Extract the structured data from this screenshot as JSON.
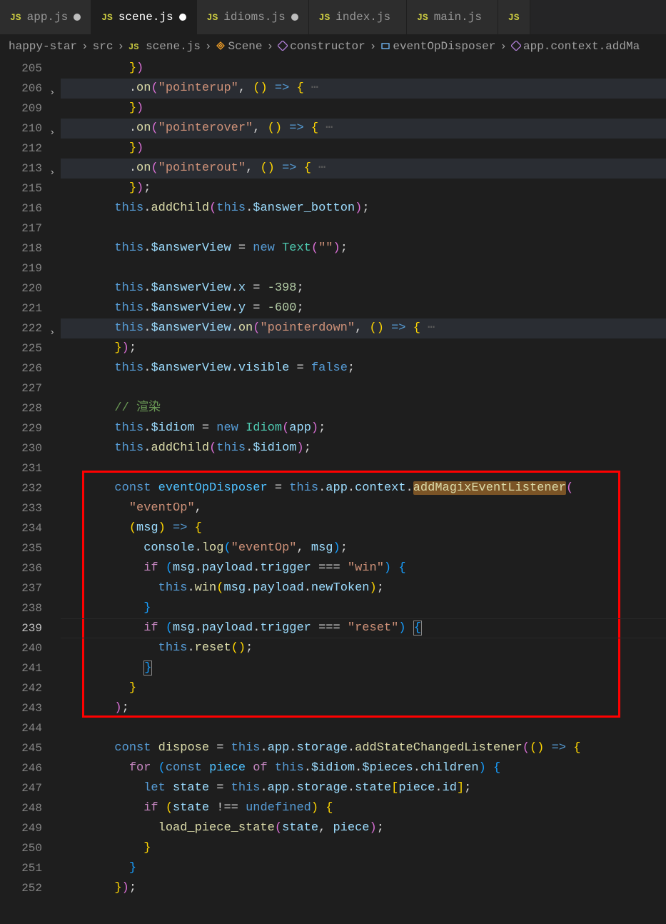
{
  "tabs": [
    {
      "label": "app.js",
      "dirty": true,
      "active": false
    },
    {
      "label": "scene.js",
      "dirty": true,
      "active": true
    },
    {
      "label": "idioms.js",
      "dirty": true,
      "active": false
    },
    {
      "label": "index.js",
      "dirty": false,
      "active": false
    },
    {
      "label": "main.js",
      "dirty": false,
      "active": false
    }
  ],
  "breadcrumbs": {
    "segments": [
      "happy-star",
      "src",
      "scene.js",
      "Scene",
      "constructor",
      "eventOpDisposer",
      "app.context.addMa"
    ]
  },
  "lines": {
    "nums": [
      "205",
      "206",
      "209",
      "210",
      "212",
      "213",
      "215",
      "216",
      "217",
      "218",
      "219",
      "220",
      "221",
      "222",
      "225",
      "226",
      "227",
      "228",
      "229",
      "230",
      "231",
      "232",
      "233",
      "234",
      "235",
      "236",
      "237",
      "238",
      "239",
      "240",
      "241",
      "242",
      "243",
      "244",
      "245",
      "246",
      "247",
      "248",
      "249",
      "250",
      "251",
      "252"
    ],
    "folds": {
      "206": true,
      "210": true,
      "213": true,
      "222": true
    },
    "current": "239"
  },
  "tokens": {
    "pointerup": "\"pointerup\"",
    "pointerover": "\"pointerover\"",
    "pointerout": "\"pointerout\"",
    "pointerdown": "\"pointerdown\"",
    "eventOp": "\"eventOp\"",
    "win": "\"win\"",
    "reset": "\"reset\"",
    "empty": "\"\"",
    "comment_render": "// 渲染",
    "neg398": "-398",
    "neg600": "-600",
    "false": "false",
    "addChild": "addChild",
    "on": "on",
    "Text": "Text",
    "Idiom": "Idiom",
    "this": "this",
    "new": "new",
    "const": "const",
    "let": "let",
    "for": "for",
    "of": "of",
    "if": "if",
    "undefined": "undefined",
    "answer_botton": "$answer_botton",
    "answerView": "$answerView",
    "idiom": "$idiom",
    "pieces": "$pieces",
    "visible": "visible",
    "x": "x",
    "y": "y",
    "app": "app",
    "context": "context",
    "storage": "storage",
    "state": "state",
    "children": "children",
    "msg": "msg",
    "payload": "payload",
    "trigger": "trigger",
    "newToken": "newToken",
    "console": "console",
    "log": "log",
    "winfn": "win",
    "resetfn": "reset",
    "eventOpDisposer": "eventOpDisposer",
    "addMagixEventListener": "addMagixEventListener",
    "dispose": "dispose",
    "addStateChangedListener": "addStateChangedListener",
    "piece": "piece",
    "id": "id",
    "load_piece_state": "load_piece_state"
  }
}
